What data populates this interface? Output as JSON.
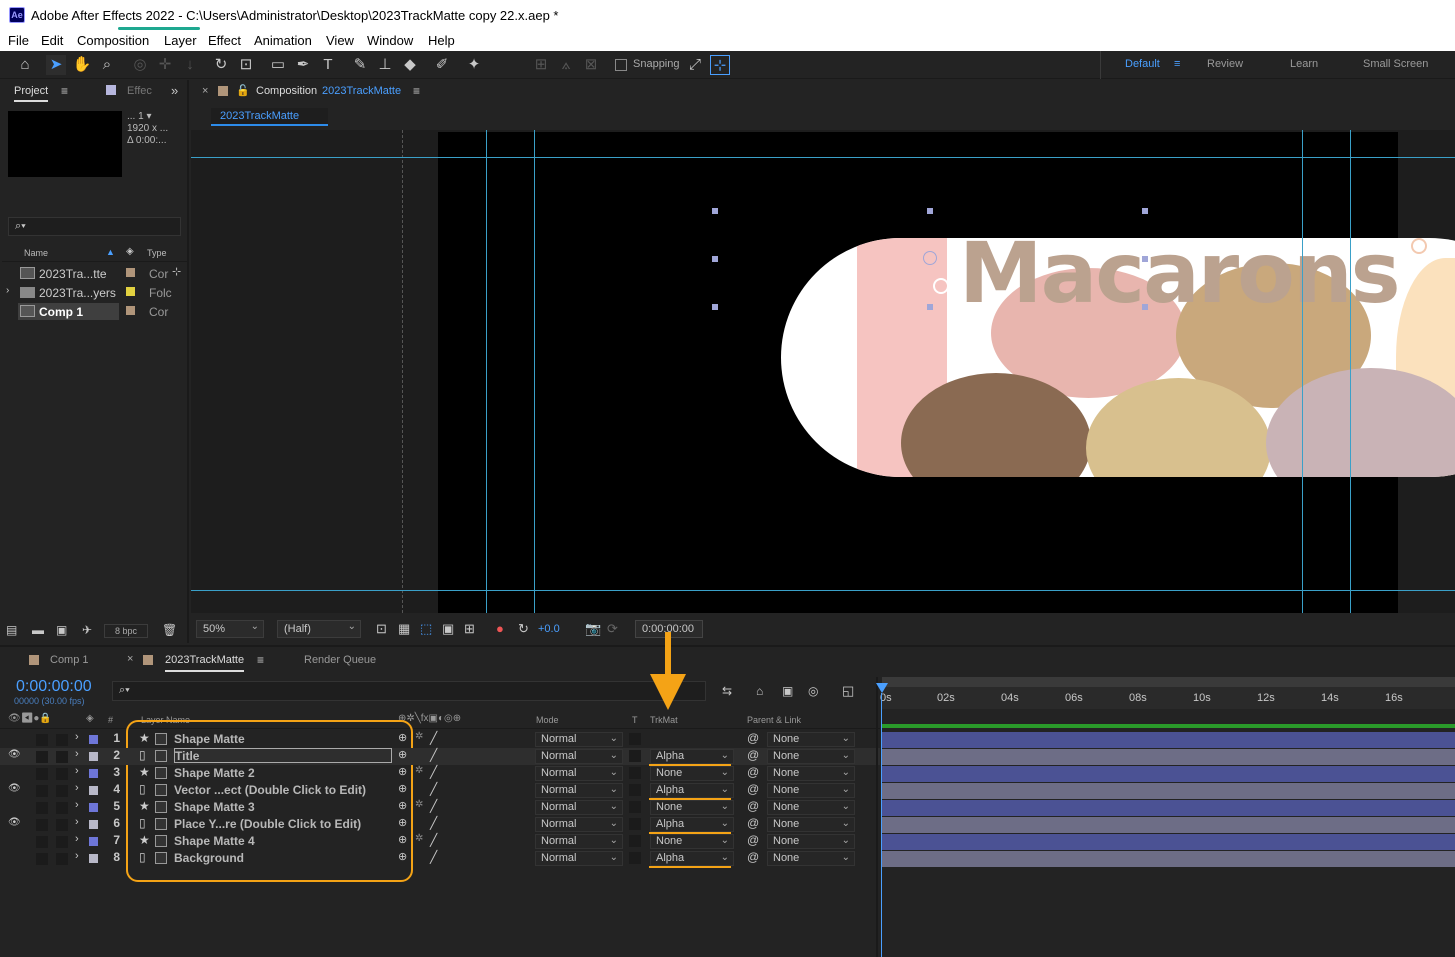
{
  "window": {
    "title": "Adobe After Effects 2022 - C:\\Users\\Administrator\\Desktop\\2023TrackMatte copy 22.x.aep *",
    "app_icon": "Ae"
  },
  "menu": [
    "File",
    "Edit",
    "Composition",
    "Layer",
    "Effect",
    "Animation",
    "View",
    "Window",
    "Help"
  ],
  "toolbar": {
    "snapping": "Snapping",
    "workspaces": [
      "Default",
      "Review",
      "Learn",
      "Small Screen"
    ]
  },
  "project": {
    "tab": "Project",
    "tab2": "Effec",
    "thumb_info": [
      "... 1 ▾",
      "1920 x ...",
      "Δ 0:00:..."
    ],
    "search_placeholder": "⌕▾",
    "col_name": "Name",
    "col_type": "Type",
    "items": [
      {
        "name": "2023Tra...tte",
        "type": "Cor",
        "selected": false
      },
      {
        "name": "2023Tra...yers",
        "type": "Folc",
        "selected": false
      },
      {
        "name": "Comp 1",
        "type": "Cor",
        "selected": true
      }
    ],
    "bpc": "8 bpc"
  },
  "composition": {
    "tab_label": "Composition",
    "comp_name": "2023TrackMatte",
    "breadcrumb": "2023TrackMatte",
    "headline": "Macarons",
    "zoom": "50%",
    "resolution": "(Half)",
    "exposure": "+0.0",
    "timecode": "0:00:00:00"
  },
  "timeline": {
    "tabs": [
      "Comp 1",
      "2023TrackMatte",
      "Render Queue"
    ],
    "timecode": "0:00:00:00",
    "fps": "00000 (30.00 fps)",
    "search_placeholder": "⌕▾",
    "headers": {
      "layer_name": "Layer Name",
      "mode": "Mode",
      "t": "T",
      "trkmat": "TrkMat",
      "parent": "Parent & Link"
    },
    "ruler": [
      "0s",
      "02s",
      "04s",
      "06s",
      "08s",
      "10s",
      "12s",
      "14s",
      "16s"
    ],
    "layers": [
      {
        "num": "1",
        "name": "Shape Matte",
        "mode": "Normal",
        "trkmat": "",
        "parent": "None",
        "color": "#6e76d8",
        "eye": false
      },
      {
        "num": "2",
        "name": "Title",
        "mode": "Normal",
        "trkmat": "Alpha",
        "parent": "None",
        "color": "#b8b8c8",
        "eye": true
      },
      {
        "num": "3",
        "name": "Shape Matte 2",
        "mode": "Normal",
        "trkmat": "None",
        "parent": "None",
        "color": "#6e76d8",
        "eye": false
      },
      {
        "num": "4",
        "name": "Vector ...ect (Double Click to Edit)",
        "mode": "Normal",
        "trkmat": "Alpha",
        "parent": "None",
        "color": "#b8b8c8",
        "eye": true
      },
      {
        "num": "5",
        "name": "Shape Matte 3",
        "mode": "Normal",
        "trkmat": "None",
        "parent": "None",
        "color": "#6e76d8",
        "eye": false
      },
      {
        "num": "6",
        "name": "Place Y...re (Double Click to Edit)",
        "mode": "Normal",
        "trkmat": "Alpha",
        "parent": "None",
        "color": "#b8b8c8",
        "eye": true
      },
      {
        "num": "7",
        "name": "Shape Matte 4",
        "mode": "Normal",
        "trkmat": "None",
        "parent": "None",
        "color": "#6e76d8",
        "eye": false
      },
      {
        "num": "8",
        "name": "Background",
        "mode": "Normal",
        "trkmat": "Alpha",
        "parent": "None",
        "color": "#b8b8c8",
        "eye": false
      }
    ]
  },
  "colors": {
    "accent": "#2d8ceb",
    "highlight": "#f4a316",
    "guide": "#3aa0c8",
    "shape_bar": "#4b5294",
    "footage_bar": "#6d6d86"
  }
}
